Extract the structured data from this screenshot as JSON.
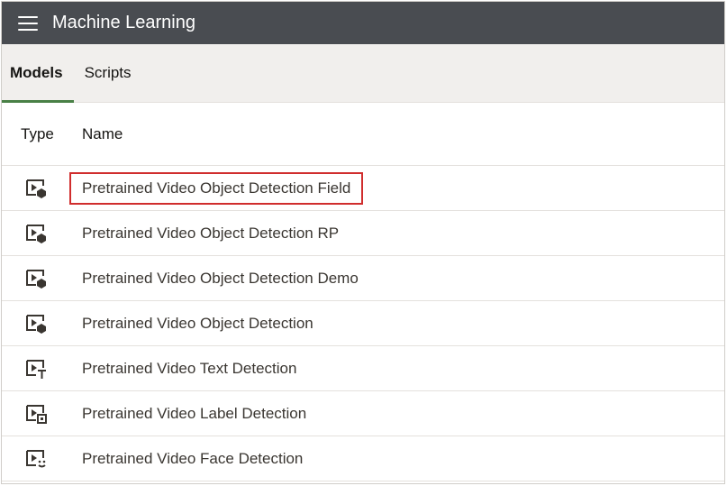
{
  "header": {
    "title": "Machine Learning",
    "menu_icon": "hamburger-menu-icon"
  },
  "tabs": [
    {
      "label": "Models",
      "active": true
    },
    {
      "label": "Scripts",
      "active": false
    }
  ],
  "table": {
    "columns": [
      "Type",
      "Name"
    ],
    "rows": [
      {
        "name": "Pretrained Video Object Detection Field",
        "icon": "video-object-detection-icon",
        "highlighted": true
      },
      {
        "name": "Pretrained Video Object Detection RP",
        "icon": "video-object-detection-icon",
        "highlighted": false
      },
      {
        "name": "Pretrained Video Object Detection Demo",
        "icon": "video-object-detection-icon",
        "highlighted": false
      },
      {
        "name": "Pretrained Video Object Detection",
        "icon": "video-object-detection-icon",
        "highlighted": false
      },
      {
        "name": "Pretrained Video Text Detection",
        "icon": "video-text-detection-icon",
        "highlighted": false
      },
      {
        "name": "Pretrained Video Label Detection",
        "icon": "video-label-detection-icon",
        "highlighted": false
      },
      {
        "name": "Pretrained Video Face Detection",
        "icon": "video-face-detection-icon",
        "highlighted": false
      }
    ]
  },
  "colors": {
    "header_bg": "#494c51",
    "tab_bar_bg": "#f1efed",
    "active_tab_underline": "#498046",
    "highlight_border": "#d02d2d"
  }
}
